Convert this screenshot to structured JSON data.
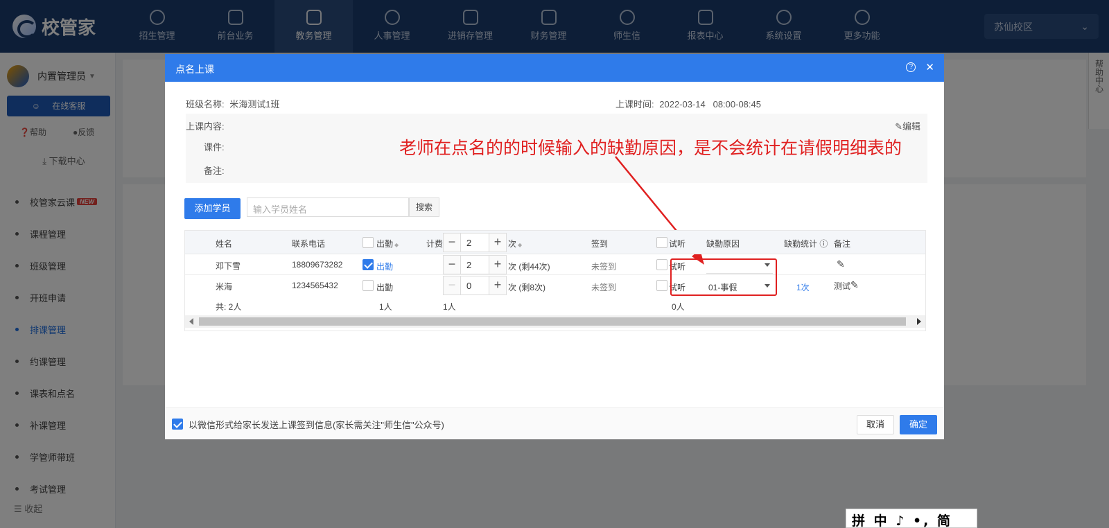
{
  "app": {
    "brand": "校管家",
    "campus": "苏仙校区"
  },
  "nav": [
    {
      "label": "招生管理",
      "icon": "user-add-icon"
    },
    {
      "label": "前台业务",
      "icon": "monitor-icon"
    },
    {
      "label": "教务管理",
      "icon": "book-icon"
    },
    {
      "label": "人事管理",
      "icon": "person-icon"
    },
    {
      "label": "进销存管理",
      "icon": "inventory-icon"
    },
    {
      "label": "财务管理",
      "icon": "finance-icon"
    },
    {
      "label": "师生信",
      "icon": "message-icon"
    },
    {
      "label": "报表中心",
      "icon": "report-icon"
    },
    {
      "label": "系统设置",
      "icon": "settings-icon"
    },
    {
      "label": "更多功能",
      "icon": "more-icon"
    }
  ],
  "sidebar": {
    "user": "内置管理员",
    "service": "在线客服",
    "help": "帮助",
    "feedback": "反馈",
    "download": "下载中心",
    "items": [
      {
        "label": "校管家云课",
        "badge": "NEW"
      },
      {
        "label": "课程管理"
      },
      {
        "label": "班级管理"
      },
      {
        "label": "开班申请"
      },
      {
        "label": "排课管理"
      },
      {
        "label": "约课管理"
      },
      {
        "label": "课表和点名"
      },
      {
        "label": "补课管理"
      },
      {
        "label": "学管师带班"
      },
      {
        "label": "考试管理"
      }
    ],
    "collapse": "收起"
  },
  "help_center": "帮助中心",
  "modal": {
    "title": "点名上课",
    "class_label": "班级名称:",
    "class_name": "米海测试1班",
    "time_label": "上课时间:",
    "time_value": "2022-03-14   08:00-08:45",
    "content_label": "上课内容:",
    "courseware_label": "课件:",
    "remark_label": "备注:",
    "edit": "编辑",
    "add_student": "添加学员",
    "search_placeholder": "输入学员姓名",
    "search_btn": "搜索",
    "columns": {
      "name": "姓名",
      "phone": "联系电话",
      "attend": "出勤",
      "fee": "计费",
      "fee_value": "2",
      "times": "次",
      "signin": "签到",
      "trial": "试听",
      "absence_reason": "缺勤原因",
      "absence_stat": "缺勤统计",
      "note": "备注"
    },
    "rows": [
      {
        "name": "邓下雪",
        "phone": "18809673282",
        "attend": "出勤",
        "attend_checked": true,
        "fee": "2",
        "times": "次 (剩44次)",
        "signin": "未签到",
        "trial": "试听",
        "reason": "",
        "stat": "",
        "note": ""
      },
      {
        "name": "米海",
        "phone": "1234565432",
        "attend": "出勤",
        "attend_checked": false,
        "fee": "0",
        "times": "次 (剩8次)",
        "signin": "未签到",
        "trial": "试听",
        "reason": "01-事假",
        "stat": "1次",
        "note": "测试"
      }
    ],
    "summary": {
      "total": "共: 2人",
      "attend": "1人",
      "fee": "1人",
      "trial": "0人"
    },
    "footer_text": "以微信形式给家长发送上课签到信息(家长需关注\"师生信\"公众号)",
    "cancel": "取消",
    "confirm": "确定"
  },
  "annotation": "老师在点名的的时候输入的缺勤原因，是不会统计在请假明细表的",
  "ime": "拼 中 ♪ •, 简 ⚙ :"
}
